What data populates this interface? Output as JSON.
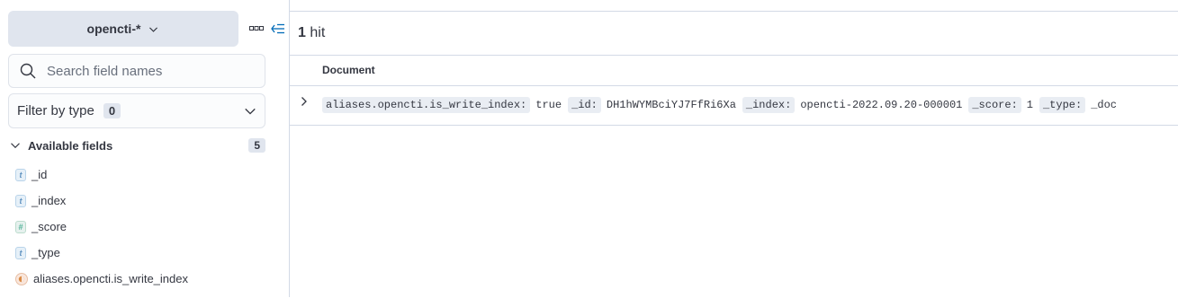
{
  "sidebar": {
    "index_pattern": "opencti-*",
    "search": {
      "placeholder": "Search field names",
      "value": ""
    },
    "filter_by_type": {
      "label": "Filter by type",
      "count": "0"
    },
    "available_fields": {
      "title": "Available fields",
      "count": "5",
      "fields": [
        {
          "type": "string",
          "token": "t",
          "name": "_id"
        },
        {
          "type": "string",
          "token": "t",
          "name": "_index"
        },
        {
          "type": "number",
          "token": "#",
          "name": "_score"
        },
        {
          "type": "string",
          "token": "t",
          "name": "_type"
        },
        {
          "type": "boolean",
          "token": "",
          "name": "aliases.opencti.is_write_index"
        }
      ]
    }
  },
  "main": {
    "hits": {
      "count": "1",
      "label": "hit"
    },
    "column_header": "Document",
    "document": {
      "pairs": [
        {
          "key": "aliases.opencti.is_write_index:",
          "value": "true"
        },
        {
          "key": "_id:",
          "value": "DH1hWYMBciYJ7FfRi6Xa"
        },
        {
          "key": "_index:",
          "value": "opencti-2022.09.20-000001"
        },
        {
          "key": "_score:",
          "value": "1"
        },
        {
          "key": "_type:",
          "value": "_doc"
        }
      ]
    }
  },
  "colors": {
    "accent": "#006bb8",
    "border": "#d3dae6",
    "index_pattern_bg": "#e0e5ee"
  },
  "icons": [
    "chevron-down-icon",
    "more-icon",
    "collapse-sidebar-icon",
    "search-icon",
    "chevron-right-icon"
  ]
}
